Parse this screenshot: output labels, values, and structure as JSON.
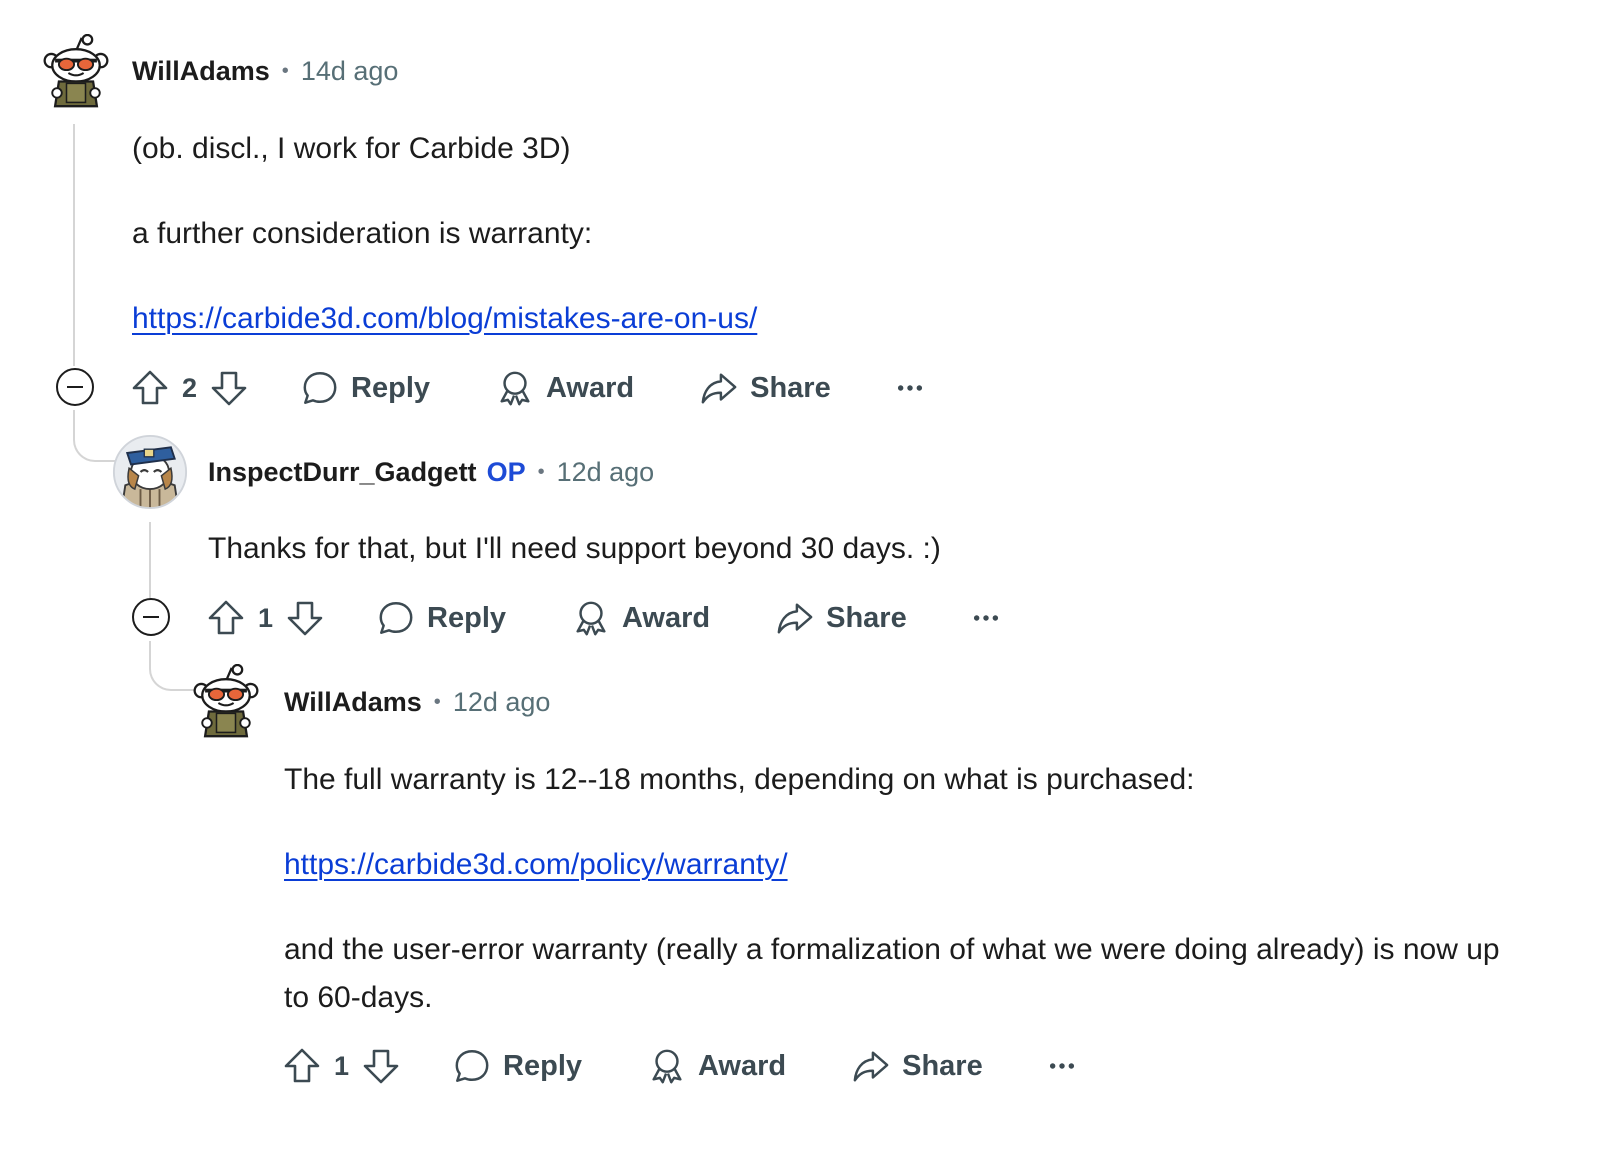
{
  "comments": [
    {
      "author": "WillAdams",
      "is_op": false,
      "time": "14d ago",
      "paragraphs": [
        "(ob. discl., I work for Carbide 3D)",
        "a further consideration is warranty:"
      ],
      "link": "https://carbide3d.com/blog/mistakes-are-on-us/",
      "score": "2",
      "avatar": "snoo-sunglasses-avatar"
    },
    {
      "author": "InspectDurr_Gadgett",
      "is_op": true,
      "op_label": "OP",
      "time": "12d ago",
      "paragraphs": [
        "Thanks for that, but I'll need support beyond 30 days. :)"
      ],
      "score": "1",
      "avatar": "captain-hat-avatar"
    },
    {
      "author": "WillAdams",
      "is_op": false,
      "time": "12d ago",
      "paragraphs": [
        "The full warranty is 12--18 months, depending on what is purchased:",
        "and the user-error warranty (really a formalization of what we were doing already) is now up to 60-days."
      ],
      "link": "https://carbide3d.com/policy/warranty/",
      "score": "1",
      "avatar": "snoo-sunglasses-avatar"
    }
  ],
  "actions": {
    "reply": "Reply",
    "award": "Award",
    "share": "Share",
    "more": "more-icon"
  },
  "colors": {
    "link": "#0a3dd6",
    "op": "#1d4bd6",
    "meta": "#576f76",
    "thread_line": "#d5d5d5"
  }
}
